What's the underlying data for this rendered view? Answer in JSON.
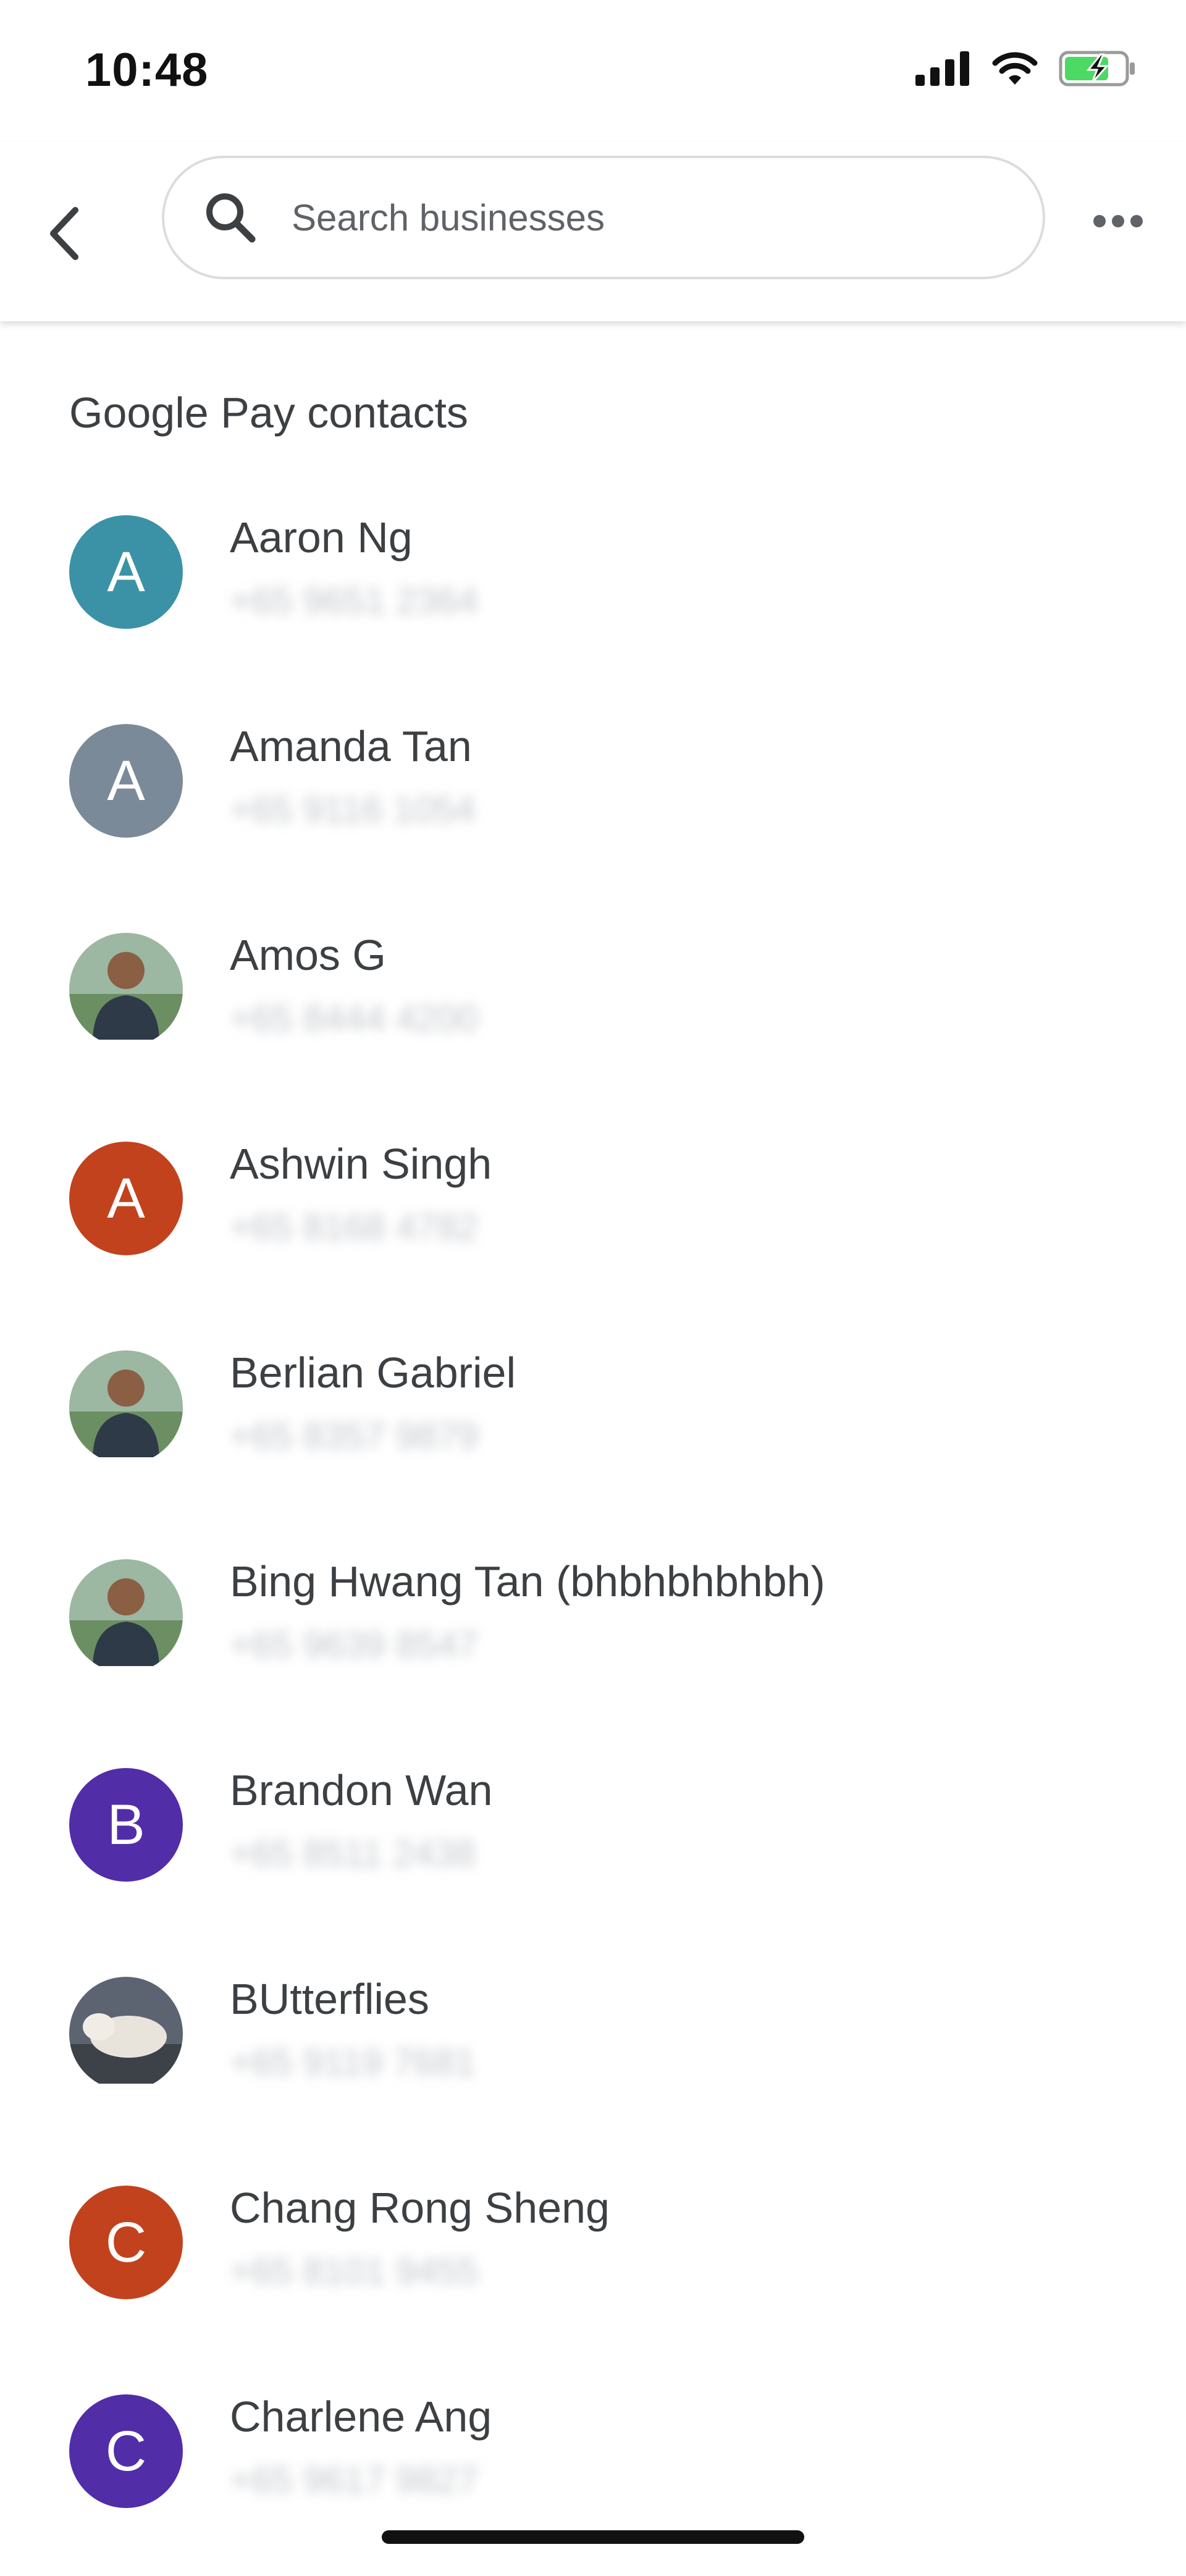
{
  "status_bar": {
    "time": "10:48",
    "icons": [
      "cellular-signal-icon",
      "wifi-icon",
      "battery-charging-icon"
    ],
    "battery_color": "#4cd964"
  },
  "app_bar": {
    "back_icon": "back-arrow-icon",
    "search": {
      "icon": "search-icon",
      "placeholder": "Search businesses",
      "value": ""
    },
    "more_icon": "more-horizontal-icon"
  },
  "section": {
    "title": "Google Pay contacts"
  },
  "contacts": [
    {
      "name": "Aaron Ng",
      "phone": "+65 9651 2364",
      "avatar": {
        "type": "initial",
        "initial": "A",
        "color": "#3b92a6"
      }
    },
    {
      "name": "Amanda Tan",
      "phone": "+65 9116 1054",
      "avatar": {
        "type": "initial",
        "initial": "A",
        "color": "#7b8a99"
      }
    },
    {
      "name": "Amos G",
      "phone": "+65 8444 4200",
      "avatar": {
        "type": "photo",
        "icon": "person-photo-icon"
      }
    },
    {
      "name": "Ashwin Singh",
      "phone": "+65 8168 4782",
      "avatar": {
        "type": "initial",
        "initial": "A",
        "color": "#c2421e"
      }
    },
    {
      "name": "Berlian Gabriel",
      "phone": "+65 8357 9879",
      "avatar": {
        "type": "photo",
        "icon": "person-photo-icon"
      }
    },
    {
      "name": "Bing Hwang Tan (bhbhbhbhbh)",
      "phone": "+65 9639 8547",
      "avatar": {
        "type": "photo",
        "icon": "person-photo-icon"
      }
    },
    {
      "name": "Brandon Wan",
      "phone": "+65 8511 2438",
      "avatar": {
        "type": "initial",
        "initial": "B",
        "color": "#512da8"
      }
    },
    {
      "name": "BUtterflies",
      "phone": "+65 9119 7681",
      "avatar": {
        "type": "photo",
        "icon": "dog-photo-icon"
      }
    },
    {
      "name": "Chang Rong Sheng",
      "phone": "+65 8101 9455",
      "avatar": {
        "type": "initial",
        "initial": "C",
        "color": "#c2421e"
      }
    },
    {
      "name": "Charlene Ang",
      "phone": "+65 9617 9827",
      "avatar": {
        "type": "initial",
        "initial": "C",
        "color": "#512da8"
      }
    }
  ]
}
